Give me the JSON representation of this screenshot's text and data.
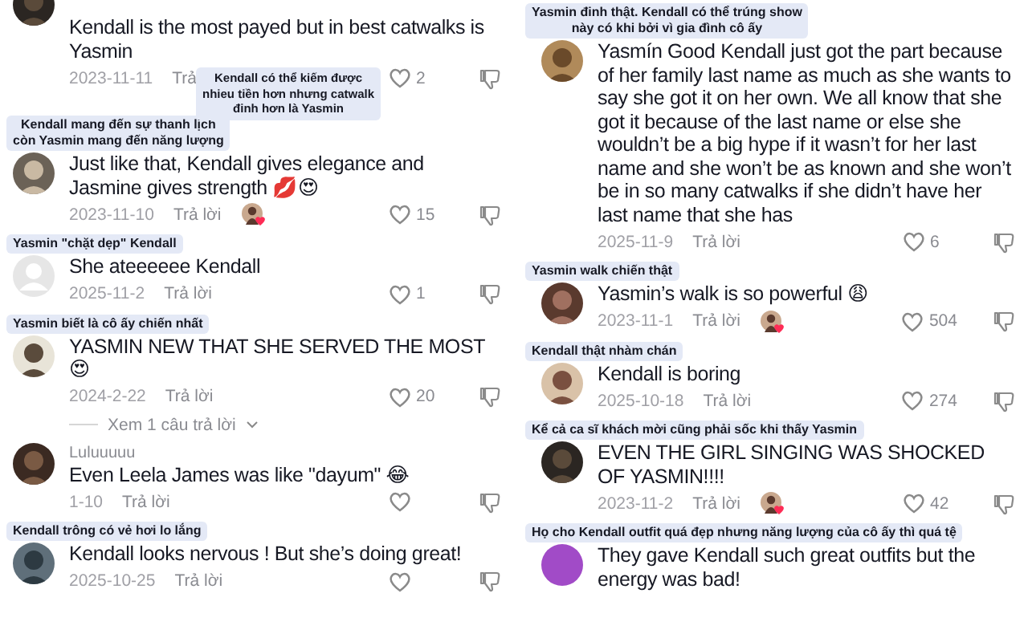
{
  "columns": [
    {
      "comments": [
        {
          "note": "Kendall có thể kiếm được\nnhieu tiền hơn nhưng catwalk\nđinh hơn là Yasmin",
          "text": "Kendall is the most payed but in best catwalks is Yasmin",
          "date": "2023-11-11",
          "reply": "Trả",
          "creator_liked": false,
          "likes": "2"
        },
        {
          "note": "Kendall mang đến sự thanh lịch\ncòn Yasmin mang đến năng lượng",
          "text": "Just like that, Kendall gives elegance and Jasmine gives strength 💋😍",
          "date": "2023-11-10",
          "reply": "Trả lời",
          "creator_liked": true,
          "likes": "15"
        },
        {
          "avatar": {
            "kind": "default"
          },
          "note": "Yasmin \"chặt dẹp\" Kendall",
          "text": "She ateeeeee Kendall",
          "date": "2025-11-2",
          "reply": "Trả lời",
          "creator_liked": false,
          "likes": "1"
        },
        {
          "note": "Yasmin biết là cô ấy chiến nhất",
          "text": "YASMIN NEW THAT SHE SERVED THE MOST 😍",
          "date": "2024-2-22",
          "reply": "Trả lời",
          "creator_liked": false,
          "likes": "20",
          "replies": "Xem 1 câu trả lời"
        },
        {
          "username": "Luluuuuu",
          "text": "Even Leela James was like \"dayum\" 😂",
          "date": "1-10",
          "reply": "Trả lời",
          "creator_liked": false
        },
        {
          "note": "Kendall trông có vẻ hơi lo lắng",
          "text": "Kendall looks nervous ! But she’s doing great!",
          "date": "2025-10-25",
          "reply": "Trả lời",
          "creator_liked": false
        }
      ]
    },
    {
      "comments": [
        {
          "note": "Yasmin đinh thật. Kendall có thể trúng show\nnày có khi bởi vì gia đình cô ấy",
          "text": "Yasmín Good Kendall just got the part because of her family last name as much as she wants to say she got it on her own. We all know that she got it because of the last name or else she wouldn’t be a big hype if it wasn’t for her last name and she won’t be as known and she won’t be in so many catwalks if she didn’t have her last name that she has",
          "date": "2025-11-9",
          "reply": "Trả lời",
          "creator_liked": false,
          "likes": "6"
        },
        {
          "note": "Yasmin walk chiến thật",
          "text": "Yasmin’s walk is so powerful 😩",
          "date": "2023-11-1",
          "reply": "Trả lời",
          "creator_liked": true,
          "likes": "504"
        },
        {
          "note": "Kendall thật nhàm chán",
          "text": "Kendall is boring",
          "date": "2025-10-18",
          "reply": "Trả lời",
          "creator_liked": false,
          "likes": "274"
        },
        {
          "note": "Kể cả ca sĩ khách mời cũng phải sốc khi thấy Yasmin",
          "text": "EVEN THE GIRL SINGING WAS SHOCKED OF YASMIN!!!!",
          "date": "2023-11-2",
          "reply": "Trả lời",
          "creator_liked": true,
          "likes": "42"
        },
        {
          "avatar": {
            "kind": "plain"
          },
          "note": "Họ cho Kendall outfit quá đẹp nhưng năng lượng của cô ấy thì quá tệ",
          "text": "They gave Kendall such great outfits but the energy was bad!"
        }
      ]
    }
  ]
}
